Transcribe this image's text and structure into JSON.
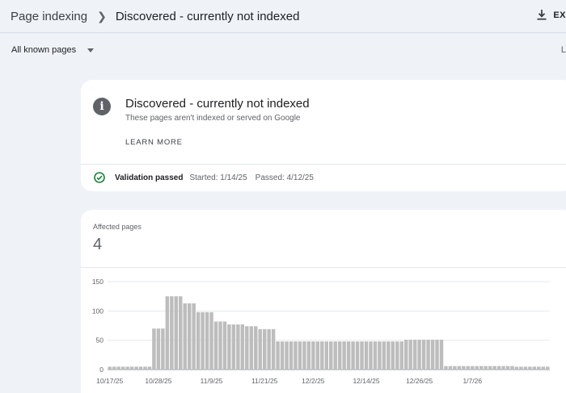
{
  "header": {
    "breadcrumb": "Page indexing",
    "title": "Discovered - currently not indexed",
    "export_label": "EX"
  },
  "filter": {
    "selected": "All known pages",
    "right_label": "L"
  },
  "status": {
    "icon": "info-icon",
    "title": "Discovered - currently not indexed",
    "subtitle": "These pages aren't indexed or served on Google",
    "learn_more": "LEARN MORE",
    "validation_label": "Validation passed",
    "started": "Started: 1/14/25",
    "passed": "Passed: 4/12/25",
    "validation_color": "#188038"
  },
  "affected": {
    "label": "Affected pages",
    "value": "4"
  },
  "chart_data": {
    "type": "bar",
    "yticks": [
      0,
      50,
      100,
      150
    ],
    "ylim": [
      0,
      150
    ],
    "xtick_labels": [
      "10/17/25",
      "10/28/25",
      "11/9/25",
      "11/21/25",
      "12/2/25",
      "12/14/25",
      "12/26/25",
      "1/7/26"
    ],
    "xtick_positions": [
      0,
      11,
      23,
      35,
      46,
      58,
      70,
      82
    ],
    "bar_color": "#bdbdbd",
    "values": [
      5,
      5,
      5,
      5,
      5,
      5,
      5,
      5,
      5,
      5,
      70,
      70,
      70,
      125,
      125,
      125,
      125,
      113,
      113,
      113,
      98,
      98,
      98,
      98,
      82,
      82,
      82,
      77,
      77,
      77,
      77,
      74,
      74,
      74,
      69,
      69,
      69,
      69,
      48,
      48,
      48,
      48,
      48,
      48,
      48,
      48,
      48,
      48,
      48,
      48,
      48,
      48,
      48,
      48,
      48,
      48,
      48,
      48,
      48,
      48,
      48,
      48,
      48,
      48,
      48,
      48,
      48,
      51,
      51,
      51,
      51,
      51,
      51,
      51,
      51,
      51,
      6,
      6,
      6,
      6,
      6,
      6,
      6,
      6,
      6,
      6,
      6,
      6,
      6,
      6,
      6,
      6,
      5,
      5,
      5,
      5,
      5,
      5,
      5,
      5
    ]
  }
}
